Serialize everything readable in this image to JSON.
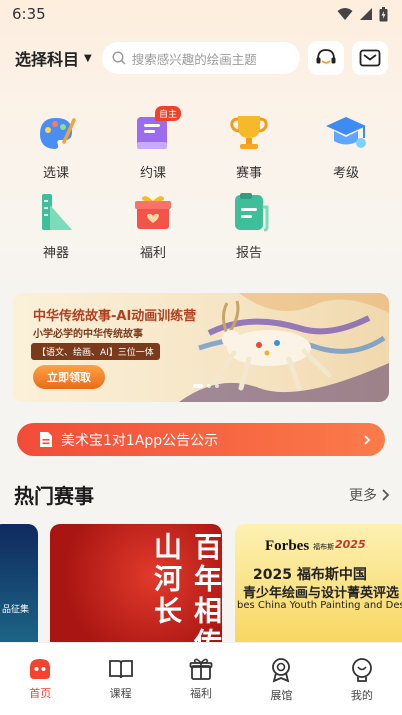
{
  "status_bar": {
    "time": "6:35"
  },
  "header": {
    "subject_label": "选择科目",
    "search_placeholder": "搜索感兴趣的绘画主题"
  },
  "grid": {
    "items": [
      {
        "label": "选课",
        "icon": "palette-icon"
      },
      {
        "label": "约课",
        "icon": "book-icon",
        "badge": "自主"
      },
      {
        "label": "赛事",
        "icon": "trophy-icon"
      },
      {
        "label": "考级",
        "icon": "graduation-cap-icon"
      },
      {
        "label": "神器",
        "icon": "ruler-triangle-icon"
      },
      {
        "label": "福利",
        "icon": "gift-box-icon"
      },
      {
        "label": "报告",
        "icon": "report-icon"
      }
    ]
  },
  "banner": {
    "title": "中华传统故事-AI动画训练营",
    "subtitle": "小学必学的中华传统故事",
    "tag": "【语文、绘画、AI】三位一体",
    "button": "立即领取"
  },
  "notice": {
    "text": "美术宝1对1App公告公示"
  },
  "hot_events": {
    "title": "热门赛事",
    "more": "更多",
    "cards": [
      {
        "text": "品征集"
      },
      {
        "text": "百年相传 山河长"
      },
      {
        "brand": "Forbes",
        "brand_cn": "福布斯",
        "year": "2025",
        "headline": "2025 福布斯中国",
        "subline": "青少年绘画与设计菁英评选",
        "english": "bes China Youth Painting and Design Elite Selec"
      }
    ]
  },
  "tabs": [
    {
      "label": "首页",
      "active": true
    },
    {
      "label": "课程"
    },
    {
      "label": "福利"
    },
    {
      "label": "展馆"
    },
    {
      "label": "我的"
    }
  ],
  "colors": {
    "accent": "#f2442f",
    "notice_start": "#f14c38",
    "notice_end": "#fb7b4a"
  }
}
